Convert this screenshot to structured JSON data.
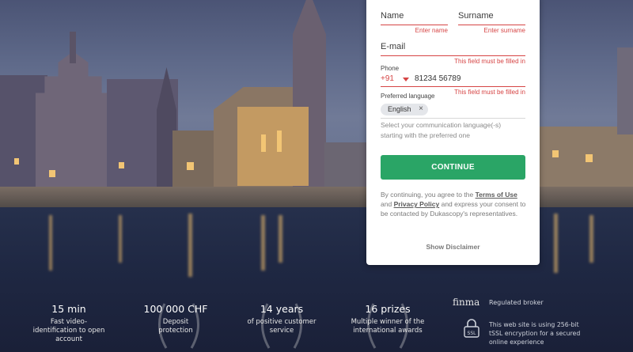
{
  "form": {
    "name_label": "Name",
    "name_error": "Enter name",
    "surname_label": "Surname",
    "surname_error": "Enter surname",
    "email_label": "E-mail",
    "email_error": "This field must be filled in",
    "phone_label": "Phone",
    "phone_code": "+91",
    "phone_value": "81234 56789",
    "phone_error": "This field must be filled in",
    "language_label": "Preferred language",
    "language_chip": "English",
    "language_chip_remove": "×",
    "language_hint": "Select your communication language(-s) starting with the preferred one",
    "continue_label": "CONTINUE",
    "terms_prefix": "By continuing, you agree to the",
    "terms_link": "Terms of Use",
    "terms_and": "and",
    "privacy_link": "Privacy Policy",
    "terms_suffix": "and express your consent to be contacted by Dukascopy's representatives.",
    "disclaimer_link": "Show Disclaimer"
  },
  "stats": [
    {
      "big": "15 min",
      "sub": "Fast video-identification to open account"
    },
    {
      "big": "100 000 CHF",
      "sub": "Deposit protection"
    },
    {
      "big": "14 years",
      "sub": "of positive customer service"
    },
    {
      "big": "16 prizes",
      "sub": "Multiple winner of the international awards"
    }
  ],
  "trust": {
    "finma_logo": "finma",
    "regulated": "Regulated broker",
    "ssl_badge": "SSL",
    "ssl_text": "This web site is using 256-bit tSSL encryption for a secured online experience"
  },
  "colors": {
    "accent_green": "#2aa566",
    "error_red": "#d64545"
  }
}
